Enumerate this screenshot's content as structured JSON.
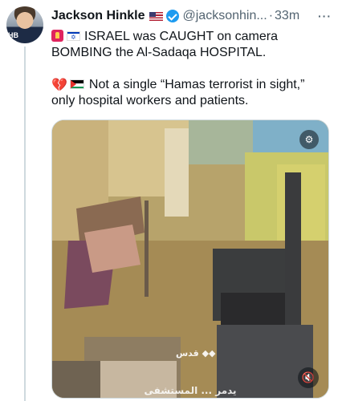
{
  "tweet": {
    "author_name": "Jackson Hinkle",
    "author_handle": "@jacksonhin...",
    "separator": "·",
    "time": "33m",
    "more": "···",
    "avatar_badge": "HB",
    "flag_icon": "us-flag-icon",
    "verified_color": "#1d9bf0",
    "line1": "ISRAEL was CAUGHT on camera BOMBING the Al-Sadaqa HOSPITAL.",
    "line2": "Not a single “Hamas terrorist in sight,” only hospital workers and patients."
  },
  "media": {
    "type": "video",
    "watermark": "قدس ◆◆",
    "caption": "يدمر ... المستشفى",
    "corner_icon": "video-settings-icon",
    "mute_icon": "muted-speaker-icon"
  }
}
